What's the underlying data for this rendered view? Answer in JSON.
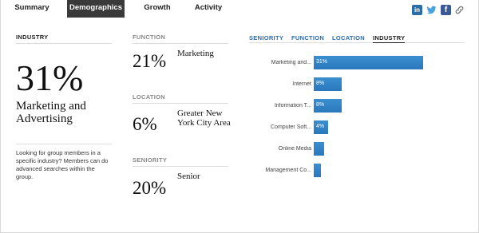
{
  "tabs": [
    {
      "label": "Summary",
      "active": false
    },
    {
      "label": "Demographics",
      "active": true
    },
    {
      "label": "Growth",
      "active": false
    },
    {
      "label": "Activity",
      "active": false
    }
  ],
  "social": {
    "linkedin_glyph": "in",
    "twitter_glyph": "🐦",
    "facebook_glyph": "f",
    "link_glyph": "🔗"
  },
  "industry": {
    "label": "INDUSTRY",
    "percent": "31%",
    "name": "Marketing and Advertising",
    "help": "Looking for group members in a specific industry? Members can do advanced searches within the group."
  },
  "function": {
    "label": "FUNCTION",
    "percent": "21%",
    "name": "Marketing"
  },
  "location": {
    "label": "LOCATION",
    "percent": "6%",
    "name": "Greater New York City Area"
  },
  "seniority": {
    "label": "SENIORITY",
    "percent": "20%",
    "name": "Senior"
  },
  "chart_tabs": [
    {
      "label": "SENIORITY",
      "active": false
    },
    {
      "label": "FUNCTION",
      "active": false
    },
    {
      "label": "LOCATION",
      "active": false
    },
    {
      "label": "INDUSTRY",
      "active": true
    }
  ],
  "colors": {
    "bar": "#2a78bb",
    "active_tab_bg": "#3a3a3a",
    "link_blue": "#2b6cb0"
  },
  "chart_data": {
    "type": "bar",
    "orientation": "horizontal",
    "categories": [
      "Marketing and...",
      "Internet",
      "Information T...",
      "Computer Soft...",
      "Online Media",
      "Management Co..."
    ],
    "values": [
      31,
      8,
      8,
      4,
      3,
      2
    ],
    "value_labels": [
      "31%",
      "8%",
      "8%",
      "4%",
      "",
      ""
    ]
  }
}
